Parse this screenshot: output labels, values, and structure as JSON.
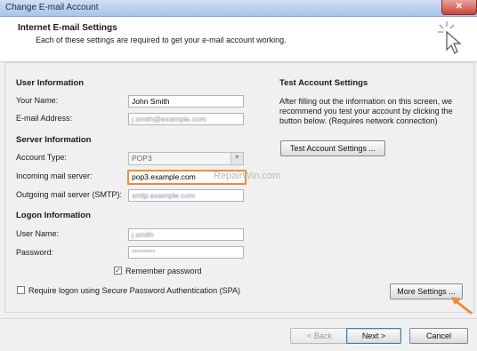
{
  "window": {
    "title": "Change E-mail Account",
    "close_glyph": "✕"
  },
  "header": {
    "title": "Internet E-mail Settings",
    "subtitle": "Each of these settings are required to get your e-mail account working.",
    "icon": "cursor-icon"
  },
  "user_info": {
    "heading": "User Information",
    "name_label": "Your Name:",
    "name_value": "John Smith",
    "email_label": "E-mail Address:",
    "email_value": "j.smith@example.com"
  },
  "server_info": {
    "heading": "Server Information",
    "account_type_label": "Account Type:",
    "account_type_value": "POP3",
    "incoming_label": "Incoming mail server:",
    "incoming_value": "pop3.example.com",
    "outgoing_label": "Outgoing mail server (SMTP):",
    "outgoing_value": "smtp.example.com"
  },
  "logon_info": {
    "heading": "Logon Information",
    "username_label": "User Name:",
    "username_value": "j.smith",
    "password_label": "Password:",
    "password_value": "********",
    "remember_label": "Remember password",
    "remember_checked": true,
    "spa_label": "Require logon using Secure Password Authentication (SPA)",
    "spa_checked": false
  },
  "test_settings": {
    "heading": "Test Account Settings",
    "description_line1": "After filling out the information on this screen, we",
    "description_line2": "recommend you test your account by clicking the",
    "description_line3": "button below. (Requires network connection)",
    "button_label": "Test Account Settings ..."
  },
  "more_settings_label": "More Settings ...",
  "watermark": "RepairWin.com",
  "footer": {
    "back_label": "< Back",
    "next_label": "Next >",
    "cancel_label": "Cancel"
  },
  "colors": {
    "accent_orange": "#ee8b34",
    "title_blue": "#a9c4e8"
  }
}
